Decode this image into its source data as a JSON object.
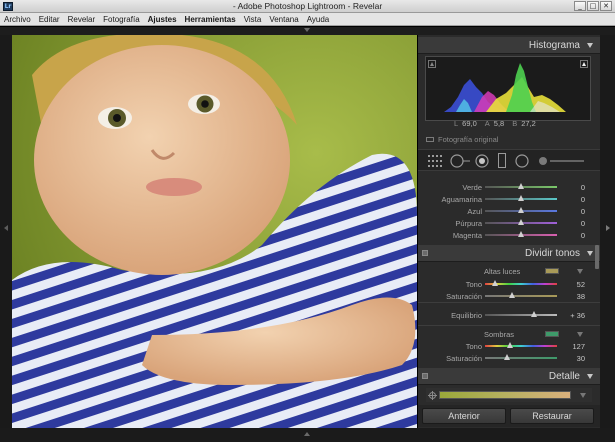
{
  "window": {
    "title": "- Adobe Photoshop Lightroom - Revelar",
    "app_icon_label": "Lr",
    "controls": [
      "_",
      "□",
      "✕"
    ]
  },
  "menu": [
    {
      "label": "Archivo"
    },
    {
      "label": "Editar"
    },
    {
      "label": "Revelar"
    },
    {
      "label": "Fotografía"
    },
    {
      "label": "Ajustes",
      "bold": true
    },
    {
      "label": "Herramientas",
      "bold": true
    },
    {
      "label": "Vista"
    },
    {
      "label": "Ventana"
    },
    {
      "label": "Ayuda"
    }
  ],
  "histogram": {
    "title": "Histograma",
    "readout": {
      "l_label": "L",
      "l_value": "69,0",
      "a_label": "A",
      "a_value": "5,8",
      "b_label": "B",
      "b_value": "27,2"
    },
    "original_label": "Fotografía original"
  },
  "hsl": {
    "rows": [
      {
        "label": "Verde",
        "value": "0",
        "pos": 0.5,
        "track": "#7ac86a"
      },
      {
        "label": "Aguamarina",
        "value": "0",
        "pos": 0.5,
        "track": "#5ac8c8"
      },
      {
        "label": "Azul",
        "value": "0",
        "pos": 0.5,
        "track": "#5a78e0"
      },
      {
        "label": "Púrpura",
        "value": "0",
        "pos": 0.5,
        "track": "#a060d8"
      },
      {
        "label": "Magenta",
        "value": "0",
        "pos": 0.5,
        "track": "#d860b0"
      }
    ]
  },
  "split_toning": {
    "title": "Dividir tonos",
    "highlights": {
      "label": "Altas luces",
      "swatch": "#a89a58",
      "hue": {
        "label": "Tono",
        "value": "52",
        "pos": 0.14
      },
      "saturation": {
        "label": "Saturación",
        "value": "38",
        "pos": 0.38
      }
    },
    "balance": {
      "label": "Equilibrio",
      "value": "+ 36",
      "pos": 0.68
    },
    "shadows": {
      "label": "Sombras",
      "swatch": "#3e9a6a",
      "hue": {
        "label": "Tono",
        "value": "127",
        "pos": 0.35
      },
      "saturation": {
        "label": "Saturación",
        "value": "30",
        "pos": 0.3
      }
    }
  },
  "detail": {
    "title": "Detalle"
  },
  "buttons": {
    "previous": "Anterior",
    "reset": "Restaurar"
  }
}
